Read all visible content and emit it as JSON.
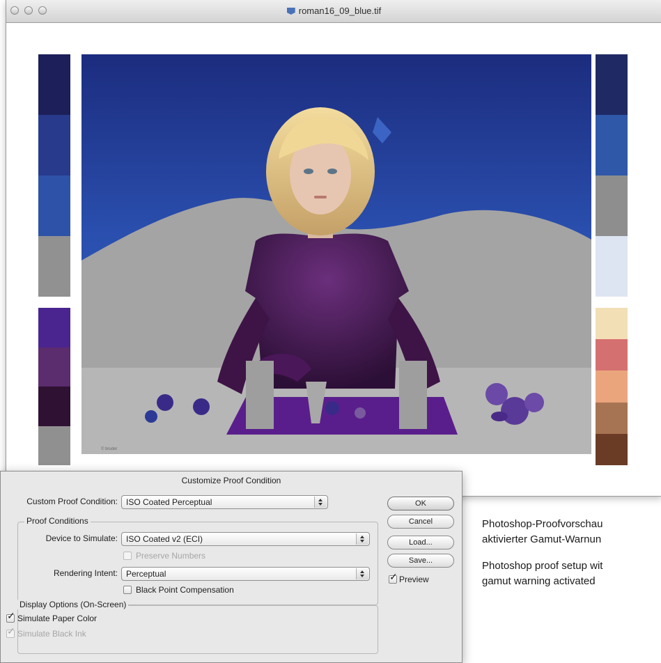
{
  "window": {
    "title": "roman16_09_blue.tif",
    "file_icon": "tif-file-icon"
  },
  "photo": {
    "credit": "© bruder"
  },
  "swatches": {
    "left_top": [
      "#1d1f5a",
      "#283a8c",
      "#2e52a8",
      "#919191"
    ],
    "left_bottom": [
      "#4a2590",
      "#5b2c6e",
      "#2f1133",
      "#909090"
    ],
    "right_top": [
      "#1f2a64",
      "#2f58a8",
      "#8e8e8e",
      "#dde4f2"
    ],
    "right_bottom": [
      "#f2dfb6",
      "#d57070",
      "#eaa57c",
      "#a77453",
      "#6a3c26"
    ]
  },
  "dialog": {
    "title": "Customize Proof Condition",
    "custom_proof_condition": {
      "label": "Custom Proof Condition:",
      "value": "ISO Coated Perceptual"
    },
    "proof_conditions": {
      "label": "Proof Conditions",
      "device_to_simulate": {
        "label": "Device to Simulate:",
        "value": "ISO Coated v2 (ECI)"
      },
      "preserve_numbers": {
        "label": "Preserve Numbers",
        "checked": false,
        "enabled": false
      },
      "rendering_intent": {
        "label": "Rendering Intent:",
        "value": "Perceptual"
      },
      "black_point_compensation": {
        "label": "Black Point Compensation",
        "checked": false
      }
    },
    "display_options": {
      "label": "Display Options (On-Screen)",
      "simulate_paper_color": {
        "label": "Simulate Paper Color",
        "checked": true
      },
      "simulate_black_ink": {
        "label": "Simulate Black Ink",
        "checked": true,
        "enabled": false
      }
    },
    "buttons": {
      "ok": "OK",
      "cancel": "Cancel",
      "load": "Load...",
      "save": "Save..."
    },
    "preview": {
      "label": "Preview",
      "checked": true
    }
  },
  "caption": {
    "german": [
      "Photoshop-Proofvorschau",
      "aktivierter Gamut-Warnun"
    ],
    "english": [
      "Photoshop proof setup wit",
      "gamut warning activated"
    ]
  }
}
